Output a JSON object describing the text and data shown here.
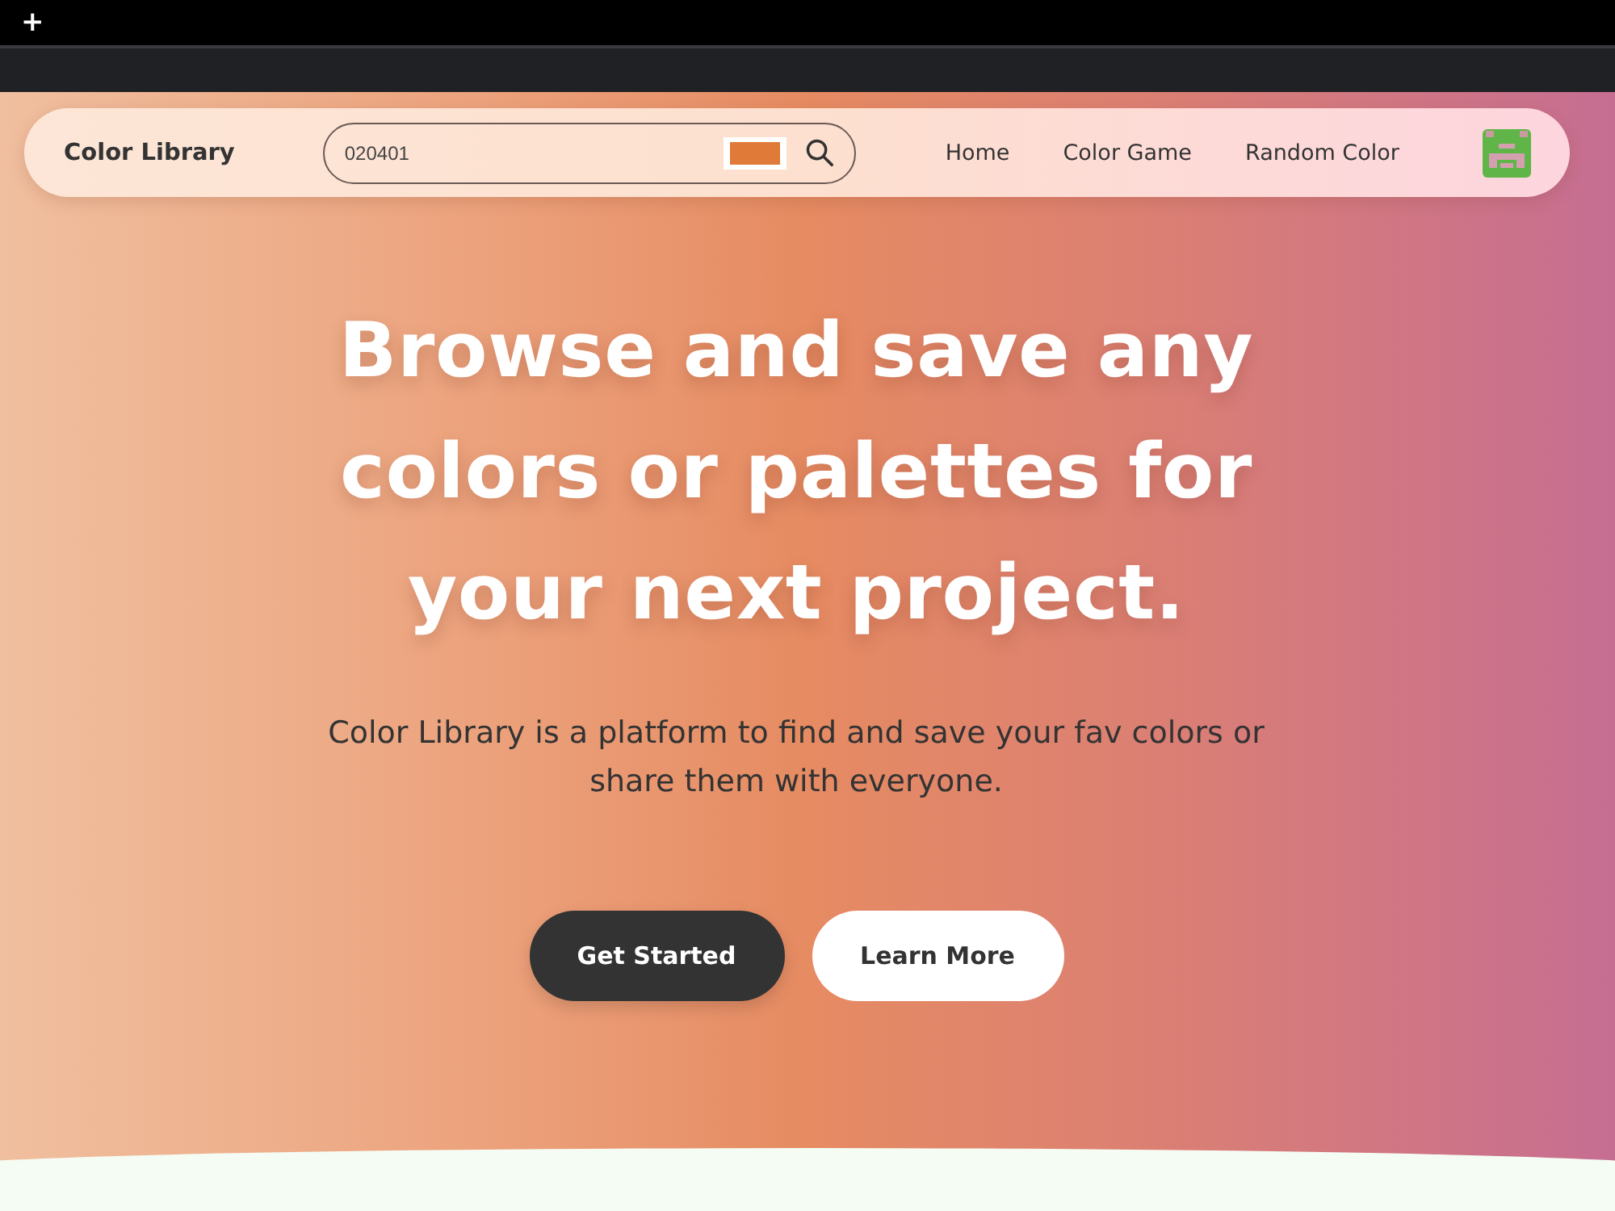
{
  "browser": {
    "new_tab_button": "+"
  },
  "navbar": {
    "brand": "Color Library",
    "search": {
      "value": "020401",
      "color": "#e07a38"
    },
    "links": [
      {
        "label": "Home"
      },
      {
        "label": "Color Game"
      },
      {
        "label": "Random Color"
      }
    ]
  },
  "hero": {
    "heading": "Browse and save any colors or palettes for your next project.",
    "description": "Color Library is a platform to find and save your fav colors or share them with everyone.",
    "buttons": [
      {
        "label": "Get Started",
        "kind": "primary"
      },
      {
        "label": "Learn More",
        "kind": "secondary"
      }
    ]
  }
}
